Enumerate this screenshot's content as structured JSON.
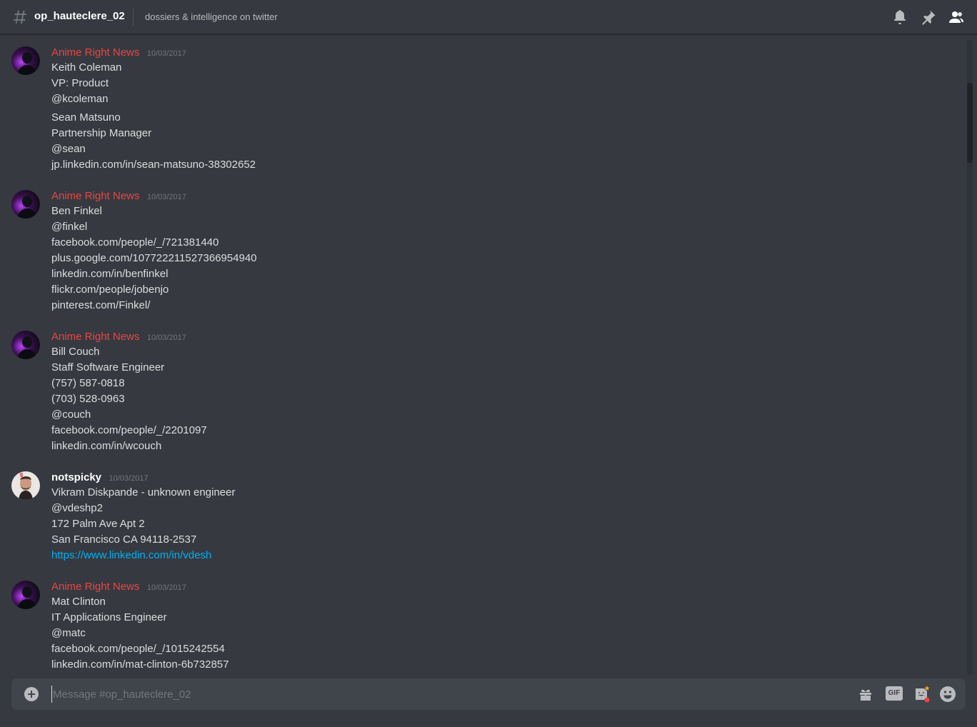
{
  "header": {
    "channel_name": "op_hauteclere_02",
    "topic": "dossiers & intelligence on twitter",
    "icons": [
      "hash-icon",
      "bell-icon",
      "pin-icon",
      "members-icon"
    ]
  },
  "messages": [
    {
      "author": "Anime Right News",
      "author_color": "#e84545",
      "timestamp": "10/03/2017",
      "lines": [
        "Keith Coleman",
        "VP: Product",
        "@kcoleman",
        "Sean Matsuno",
        "Partnership Manager",
        "@sean",
        "jp.linkedin.com/in/sean-matsuno-38302652"
      ]
    },
    {
      "author": "Anime Right News",
      "author_color": "#e84545",
      "timestamp": "10/03/2017",
      "lines": [
        "Ben Finkel",
        "@finkel",
        "facebook.com/people/_/721381440",
        "plus.google.com/107722211527366954940",
        "linkedin.com/in/benfinkel",
        "flickr.com/people/jobenjo",
        "pinterest.com/Finkel/"
      ]
    },
    {
      "author": "Anime Right News",
      "author_color": "#e84545",
      "timestamp": "10/03/2017",
      "lines": [
        "Bill Couch",
        "Staff Software Engineer",
        "(757) 587-0818",
        "(703) 528-0963",
        "@couch",
        "facebook.com/people/_/2201097",
        "linkedin.com/in/wcouch"
      ]
    },
    {
      "author": "notspicky",
      "author_color": "#ffffff",
      "timestamp": "10/03/2017",
      "lines": [
        "Vikram Diskpande - unknown engineer",
        "@vdeshp2",
        "172 Palm Ave Apt 2",
        "San Francisco CA 94118-2537"
      ],
      "link": "https://www.linkedin.com/in/vdesh"
    },
    {
      "author": "Anime Right News",
      "author_color": "#e84545",
      "timestamp": "10/03/2017",
      "lines": [
        "Mat Clinton",
        "IT Applications Engineer",
        "@matc",
        "facebook.com/people/_/1015242554",
        "linkedin.com/in/mat-clinton-6b732857"
      ]
    }
  ],
  "composer": {
    "placeholder": "Message #op_hauteclere_02",
    "icons": [
      "upload-plus-icon",
      "gift-icon",
      "gif-icon",
      "sticker-icon",
      "emoji-icon"
    ],
    "gif_label": "GIF"
  },
  "colors": {
    "background": "#36393f",
    "composer_bg": "#40444b",
    "link": "#00b0f4",
    "username_red": "#e84545"
  }
}
